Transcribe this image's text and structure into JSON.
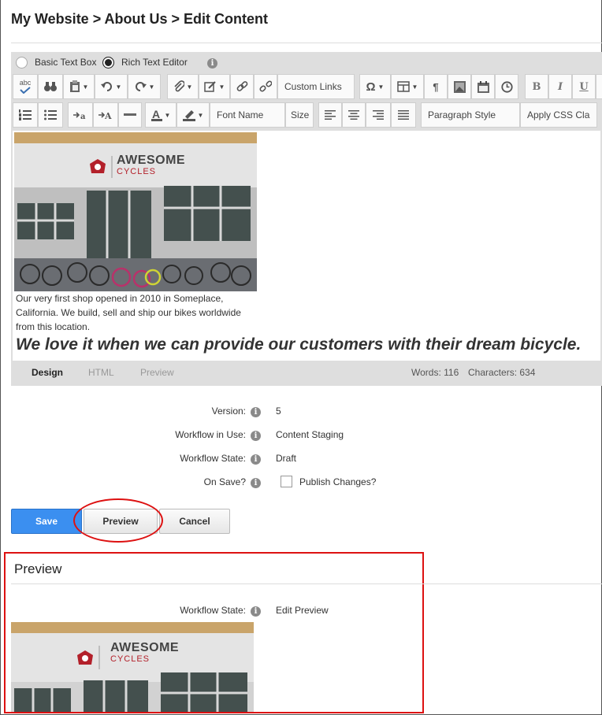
{
  "breadcrumb": "My Website > About Us > Edit Content",
  "editor": {
    "modes": [
      "Basic Text Box",
      "Rich Text Editor"
    ],
    "selected_mode": "Rich Text Editor",
    "toolbar": {
      "custom_links": "Custom Links",
      "font_name": "Font Name",
      "font_size": "Size",
      "paragraph_style": "Paragraph Style",
      "apply_css": "Apply CSS Cla",
      "spellcheck_text": "abc",
      "pilcrow": "¶",
      "omega": "Ω",
      "bold": "B",
      "italic": "I",
      "underline": "U"
    },
    "image_logo": {
      "line1": "AWESOME",
      "line2": "CYCLES"
    },
    "paragraph": "Our very first shop opened in 2010 in Someplace, California. We build, sell and ship our bikes worldwide from this location.",
    "quote": "We love it when we can provide our customers with their dream bicycle.",
    "tabs": [
      "Design",
      "HTML",
      "Preview"
    ],
    "active_tab": "Design",
    "words_label": "Words: 116",
    "chars_label": "Characters: 634"
  },
  "fields": {
    "version": {
      "label": "Version:",
      "value": "5"
    },
    "workflow": {
      "label": "Workflow in Use:",
      "value": "Content Staging"
    },
    "state": {
      "label": "Workflow State:",
      "value": "Draft"
    },
    "on_save": {
      "label": "On Save?",
      "checkbox_label": "Publish Changes?",
      "checked": false
    }
  },
  "buttons": {
    "save": "Save",
    "preview": "Preview",
    "cancel": "Cancel"
  },
  "preview": {
    "title": "Preview",
    "state_label": "Workflow State:",
    "state_value": "Edit Preview"
  },
  "colors": {
    "accent": "#3b8ff0",
    "highlight": "#dd1111",
    "logo_red": "#b3202a"
  }
}
